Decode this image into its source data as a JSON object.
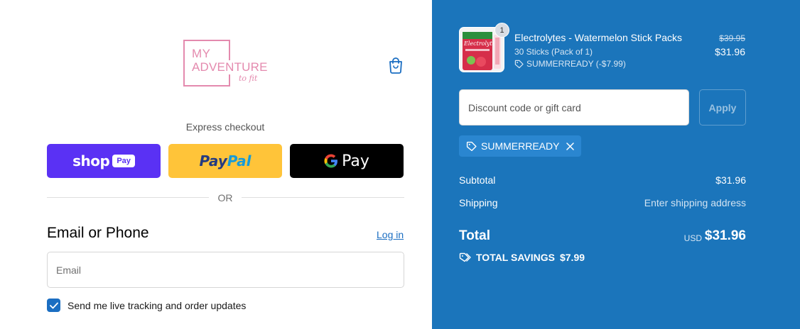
{
  "brand": {
    "logo_line1": "MY",
    "logo_line2": "ADVENTURE",
    "logo_tagline": "to fit"
  },
  "express": {
    "label": "Express checkout",
    "shop_label": "shop",
    "shop_pay_label": "Pay",
    "paypal_label_1": "Pay",
    "paypal_label_2": "Pal",
    "gpay_label": "Pay"
  },
  "divider": {
    "or_label": "OR"
  },
  "contact": {
    "heading": "Email or Phone",
    "login_label": "Log in",
    "email_placeholder": "Email",
    "email_value": "",
    "updates_label": "Send me live tracking and order updates",
    "updates_checked": true
  },
  "cart_item": {
    "quantity": "1",
    "name": "Electrolytes - Watermelon Stick Packs",
    "variant": "30 Sticks (Pack of 1)",
    "discount": "SUMMERREADY (-$7.99)",
    "original_price": "$39.95",
    "price": "$31.96",
    "thumb_label": "Electrolytes"
  },
  "discount": {
    "placeholder": "Discount code or gift card",
    "apply_label": "Apply",
    "applied_code": "SUMMERREADY"
  },
  "summary": {
    "subtotal_label": "Subtotal",
    "subtotal_value": "$31.96",
    "shipping_label": "Shipping",
    "shipping_value": "Enter shipping address",
    "total_label": "Total",
    "currency": "USD",
    "total_value": "$31.96",
    "savings_label": "TOTAL SAVINGS",
    "savings_value": "$7.99"
  },
  "colors": {
    "sidebar_bg": "#1b75bb",
    "shop_pay": "#5a31f4",
    "paypal": "#ffc439",
    "gpay": "#000000",
    "link": "#1b6ec2",
    "logo_pink": "#e48aae"
  },
  "icons": {
    "cart": "shopping-bag-icon",
    "tag": "tag-icon",
    "remove": "close-icon",
    "savings": "tags-icon",
    "check": "checkmark-icon"
  }
}
